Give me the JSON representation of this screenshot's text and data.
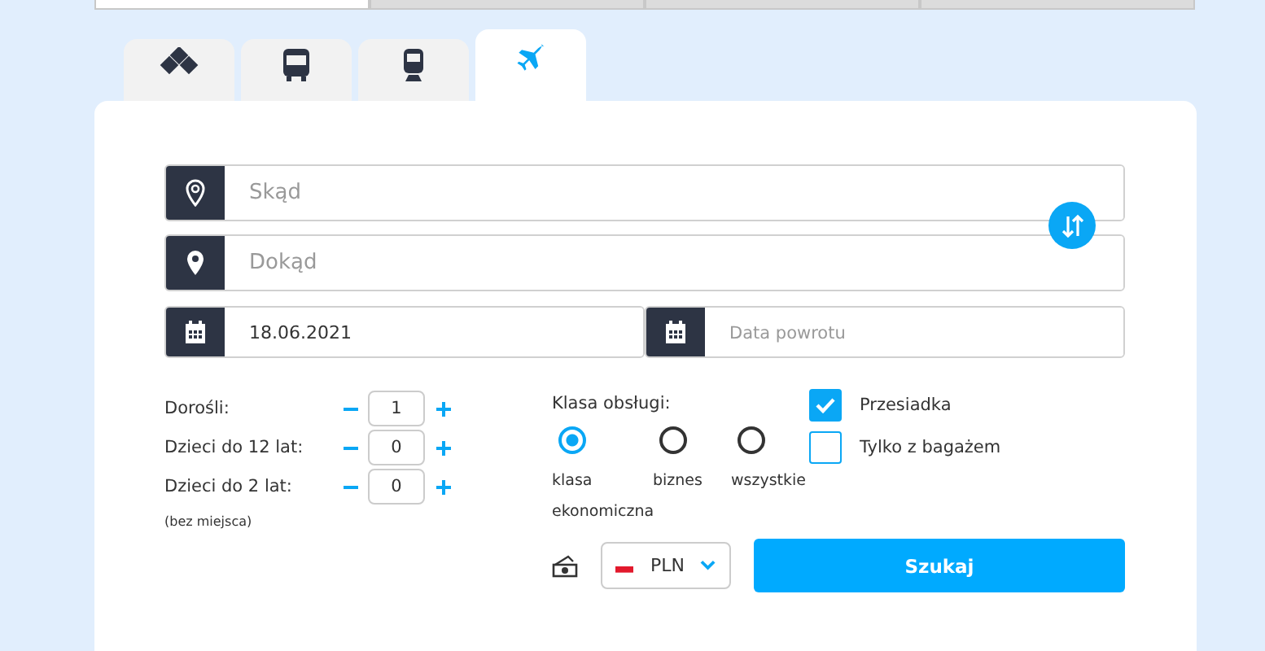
{
  "top_tabs": [
    {
      "selected": true
    },
    {
      "selected": false
    },
    {
      "selected": false
    },
    {
      "selected": false
    }
  ],
  "mode_tabs": [
    {
      "kind": "multi",
      "selected": false
    },
    {
      "kind": "bus",
      "selected": false
    },
    {
      "kind": "train",
      "selected": false
    },
    {
      "kind": "plane",
      "selected": true
    }
  ],
  "from": {
    "placeholder": "Skąd"
  },
  "to": {
    "placeholder": "Dokąd"
  },
  "depart": {
    "value": "18.06.2021"
  },
  "return": {
    "placeholder": "Data powrotu"
  },
  "passengers": [
    {
      "label": "Dorośli:",
      "value": "1"
    },
    {
      "label": "Dzieci do 12 lat:",
      "value": "0"
    },
    {
      "label": "Dzieci do 2 lat:",
      "value": "0",
      "note": "(bez miejsca)"
    }
  ],
  "class_label": "Klasa obsługi:",
  "classes": [
    {
      "label": "klasa ekonomiczna",
      "selected": true
    },
    {
      "label": "biznes",
      "selected": false
    },
    {
      "label": "wszystkie",
      "selected": false
    }
  ],
  "options": [
    {
      "label": "Przesiadka",
      "checked": true
    },
    {
      "label": "Tylko z bagażem",
      "checked": false
    }
  ],
  "currency": "PLN",
  "search_button": "Szukaj"
}
